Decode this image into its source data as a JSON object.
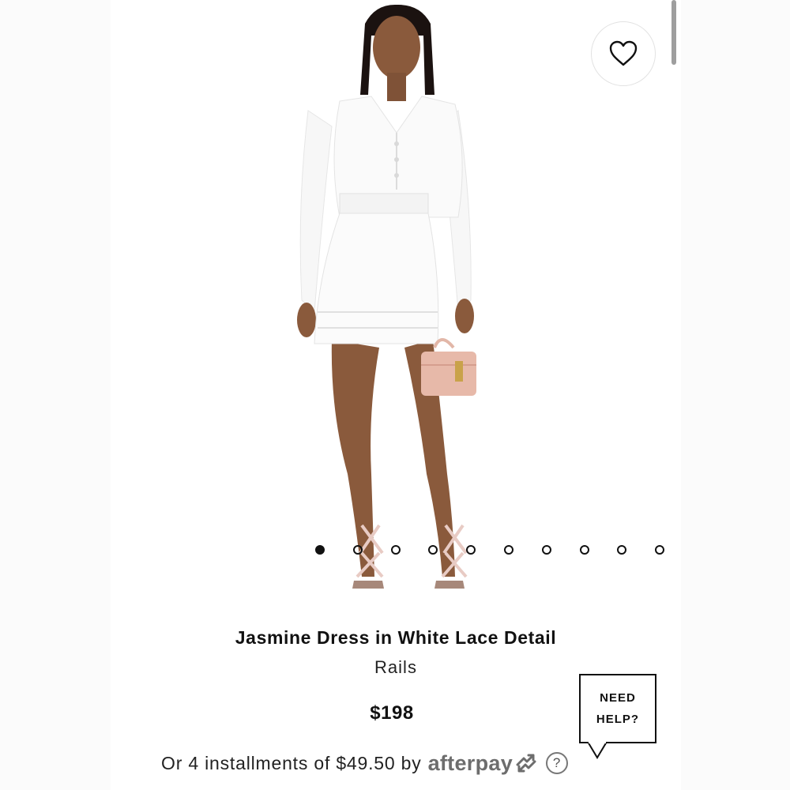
{
  "product": {
    "title": "Jasmine Dress in White Lace Detail",
    "brand": "Rails",
    "price": "$198"
  },
  "carousel": {
    "total_images": 11,
    "active_index": 0
  },
  "favorite": {
    "icon": "heart-outline-icon"
  },
  "payment": {
    "installment_text": "Or 4 installments of $49.50 by",
    "provider": "afterpay",
    "provider_color": "#6d6d6d",
    "help_icon": "?"
  },
  "help_bubble": {
    "line1": "NEED",
    "line2": "HELP?"
  }
}
